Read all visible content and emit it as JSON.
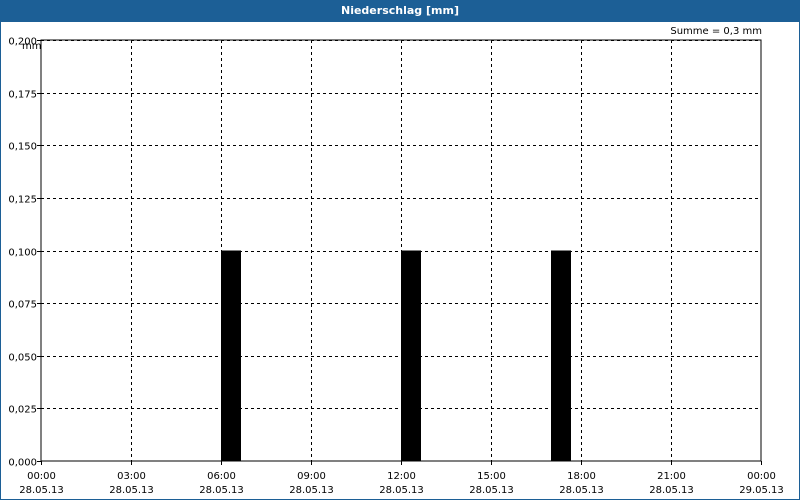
{
  "window": {
    "title": "Niederschlag [mm]"
  },
  "summary": {
    "text": "Summe = 0,3 mm"
  },
  "chart_data": {
    "type": "bar",
    "title": "Niederschlag [mm]",
    "ylabel": "mm",
    "xlabel": "",
    "ylim": [
      0,
      0.2
    ],
    "xlim": [
      "28.05.13 00:00",
      "29.05.13 00:00"
    ],
    "y_ticks": [
      "0,000",
      "0,025",
      "0,050",
      "0,075",
      "0,100",
      "0,125",
      "0,150",
      "0,175",
      "0,200"
    ],
    "x_ticks": [
      {
        "time": "00:00",
        "date": "28.05.13"
      },
      {
        "time": "03:00",
        "date": "28.05.13"
      },
      {
        "time": "06:00",
        "date": "28.05.13"
      },
      {
        "time": "09:00",
        "date": "28.05.13"
      },
      {
        "time": "12:00",
        "date": "28.05.13"
      },
      {
        "time": "15:00",
        "date": "28.05.13"
      },
      {
        "time": "18:00",
        "date": "28.05.13"
      },
      {
        "time": "21:00",
        "date": "28.05.13"
      },
      {
        "time": "00:00",
        "date": "29.05.13"
      }
    ],
    "bars": [
      {
        "start": "28.05.13 06:00",
        "end": "28.05.13 06:40",
        "value": 0.1
      },
      {
        "start": "28.05.13 12:00",
        "end": "28.05.13 12:40",
        "value": 0.1
      },
      {
        "start": "28.05.13 17:00",
        "end": "28.05.13 17:40",
        "value": 0.1
      }
    ],
    "grid": true,
    "bar_color": "#000000"
  }
}
